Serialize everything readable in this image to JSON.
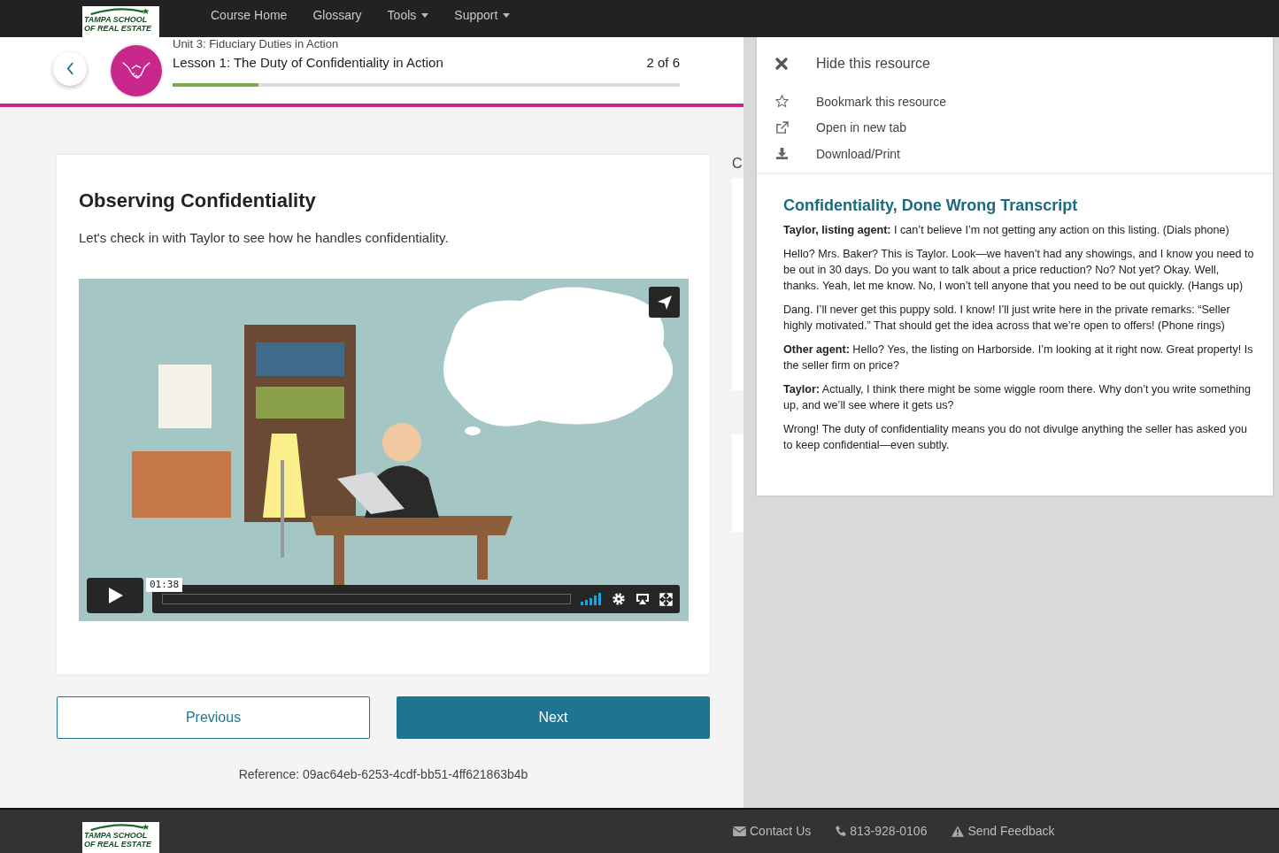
{
  "nav": {
    "logo": [
      "TAMPA SCHOOL",
      "OF REAL ESTATE"
    ],
    "items": [
      {
        "label": "Course Home",
        "dropdown": false
      },
      {
        "label": "Glossary",
        "dropdown": false
      },
      {
        "label": "Tools",
        "dropdown": true
      },
      {
        "label": "Support",
        "dropdown": true
      }
    ]
  },
  "lesson_header": {
    "unit": "Unit 3: Fiduciary Duties in Action",
    "lesson": "Lesson 1: The Duty of Confidentiality in Action",
    "position": "2 of 6",
    "progress": {
      "level": 0.17
    }
  },
  "content": {
    "title": "Observing Confidentiality",
    "intro": "Let's check in with Taylor to see how he handles confidentiality.",
    "video": {
      "kind": "picture",
      "time": "01:38"
    }
  },
  "buttons": [
    {
      "label": "Previous",
      "kind": "secondary"
    },
    {
      "label": "Next",
      "kind": "primary"
    }
  ],
  "reference": "Reference: 09ac64eb-6253-4cdf-bb51-4ff621863b4b",
  "side_peek": {
    "heading": "C"
  },
  "resource_panel": {
    "actions": [
      {
        "label": "Hide this resource"
      },
      {
        "label": "Bookmark this resource"
      },
      {
        "label": "Open in new tab"
      },
      {
        "label": "Download/Print"
      }
    ],
    "transcript": {
      "title": "Confidentiality, Done Wrong Transcript",
      "paragraphs": [
        "**Taylor, listing agent:** I can’t believe I’m not getting any action on this listing. (Dials phone)",
        "Hello? Mrs. Baker? This is Taylor. Look—we haven’t had any showings, and I know you need to be out in 30 days. Do you want to talk about a price reduction? No? Not yet? Okay. Well, thanks. Yeah, let me know. No, I won’t tell anyone that you need to be out quickly. (Hangs up)",
        "Dang. I’ll never get this puppy sold. I know! I’ll just write here in the private remarks: “Seller highly motivated.” That should get the idea across that we’re open to offers! (Phone rings)",
        "**Other agent:** Hello? Yes, the listing on Harborside. I’m looking at it right now. Great property! Is the seller firm on price?",
        "**Taylor:** Actually, I think there might be some wiggle room there. Why don’t you write something up, and we’ll see where it gets us?",
        "Wrong! The duty of confidentiality means you do not divulge anything the seller has asked you to keep confidential—even subtly."
      ]
    }
  },
  "footer": {
    "logo": [
      "TAMPA SCHOOL",
      "OF REAL ESTATE"
    ],
    "links": [
      {
        "label": "Contact Us"
      },
      {
        "label": "813-928-0106"
      },
      {
        "label": "Send Feedback"
      }
    ]
  }
}
